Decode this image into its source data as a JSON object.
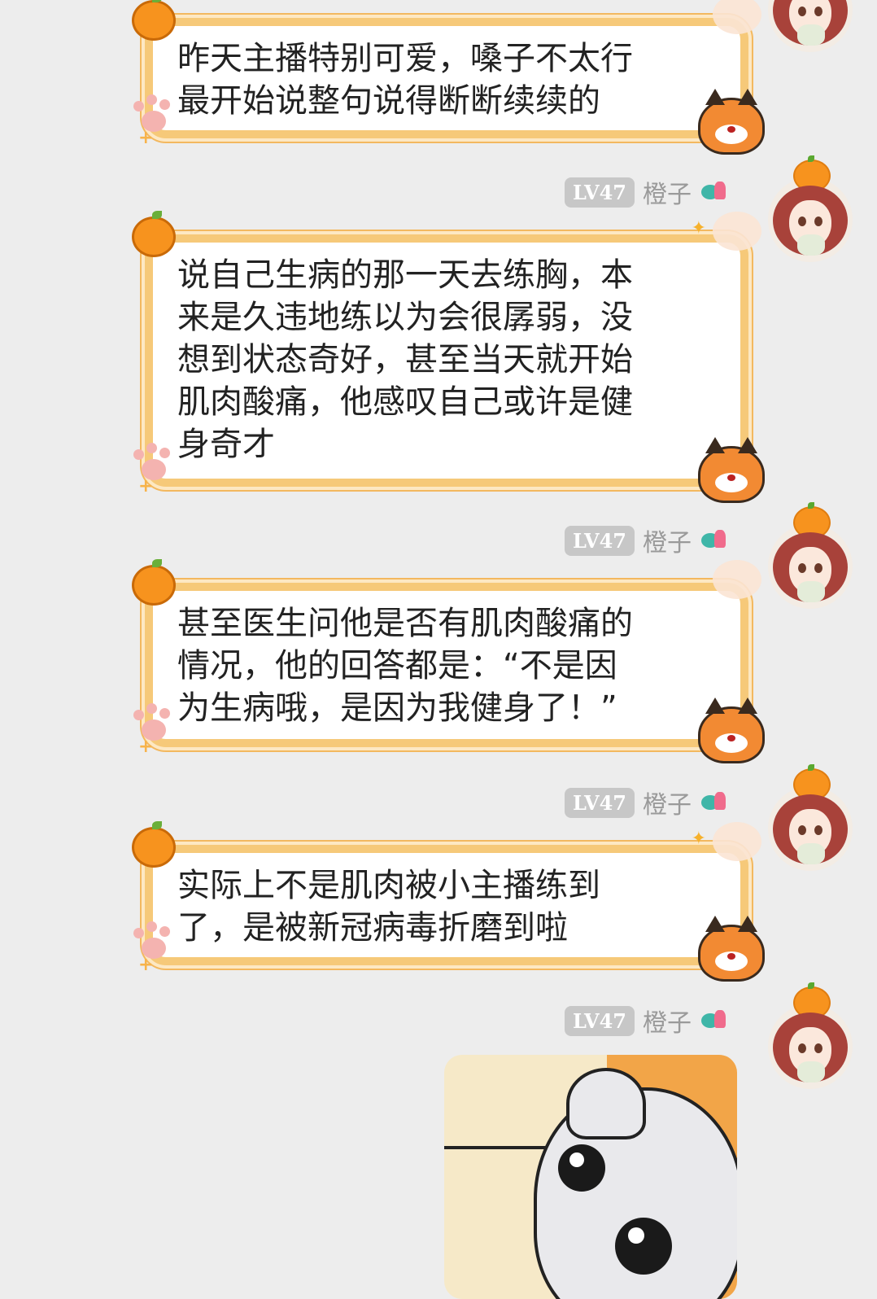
{
  "messages": [
    {
      "sender": {
        "level": "",
        "name": ""
      },
      "text": "昨天主播特别可爱，嗓子不太行\n最开始说整句说得断断续续的"
    },
    {
      "sender": {
        "level": "LV47",
        "name": "橙子"
      },
      "text": "说自己生病的那一天去练胸，本\n来是久违地练以为会很孱弱，没\n想到状态奇好，甚至当天就开始\n肌肉酸痛，他感叹自己或许是健\n身奇才"
    },
    {
      "sender": {
        "level": "LV47",
        "name": "橙子"
      },
      "text": "甚至医生问他是否有肌肉酸痛的\n情况，他的回答都是：“不是因\n为生病哦，是因为我健身了！”"
    },
    {
      "sender": {
        "level": "LV47",
        "name": "橙子"
      },
      "text": "实际上不是肌肉被小主播练到\n了，是被新冠病毒折磨到啦"
    },
    {
      "sender": {
        "level": "LV47",
        "name": "橙子"
      },
      "text": ""
    }
  ],
  "colors": {
    "background": "#ededed",
    "bubble_border": "#f6c979",
    "level_badge": "#c7c7c7",
    "nickname": "#9a9a9a"
  },
  "icons": [
    "orange-icon",
    "paw-icon",
    "fox-icon",
    "medal-badge-icon",
    "user-avatar"
  ]
}
